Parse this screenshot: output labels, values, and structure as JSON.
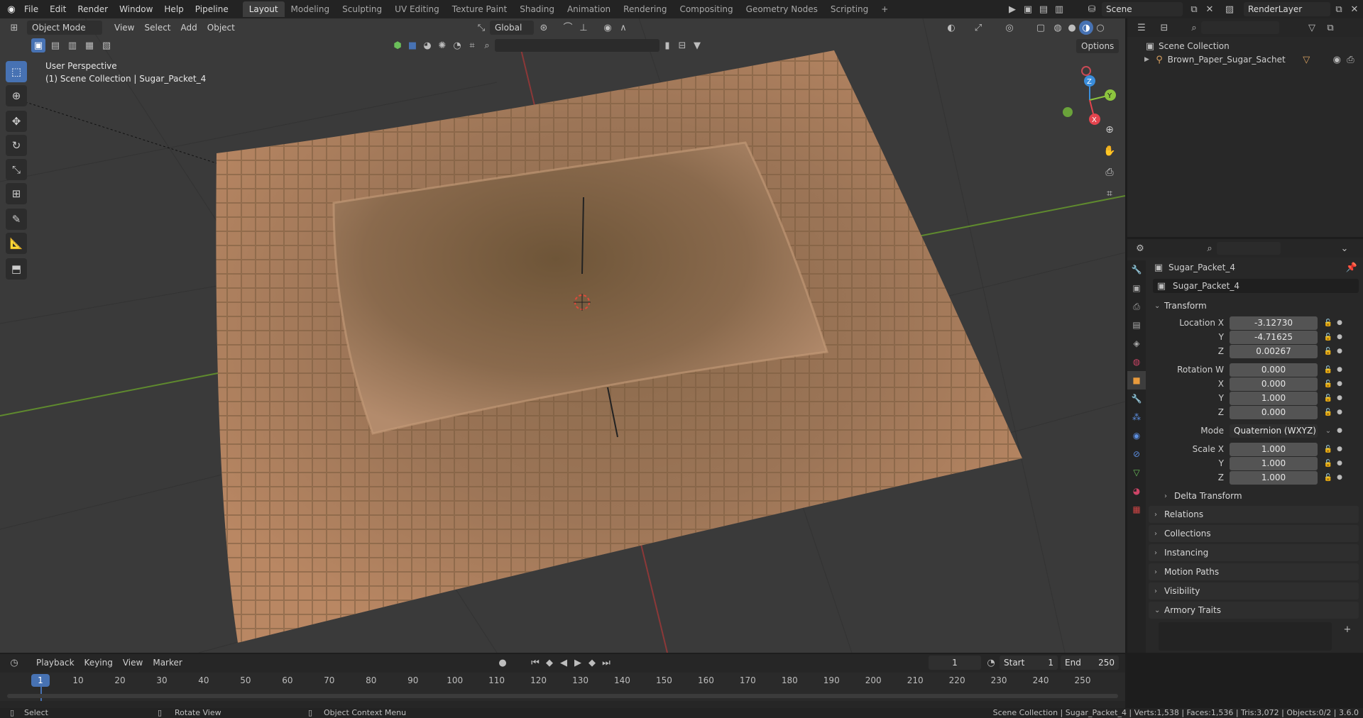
{
  "topbar": {
    "menus": [
      "File",
      "Edit",
      "Render",
      "Window",
      "Help",
      "Pipeline"
    ],
    "workspaces": [
      "Layout",
      "Modeling",
      "Sculpting",
      "UV Editing",
      "Texture Paint",
      "Shading",
      "Animation",
      "Rendering",
      "Compositing",
      "Geometry Nodes",
      "Scripting"
    ],
    "active_workspace": "Layout",
    "add_tab": "+",
    "scene_name": "Scene",
    "view_layer": "RenderLayer"
  },
  "viewport": {
    "mode": "Object Mode",
    "menus": [
      "View",
      "Select",
      "Add",
      "Object"
    ],
    "orientation": "Global",
    "options_label": "Options",
    "overlay_title": "User Perspective",
    "overlay_subtitle": "(1) Scene Collection | Sugar_Packet_4",
    "gizmo": {
      "x": "X",
      "y": "Y",
      "z": "Z"
    }
  },
  "outliner": {
    "root": "Scene Collection",
    "item": "Brown_Paper_Sugar_Sachet"
  },
  "properties": {
    "object_name": "Sugar_Packet_4",
    "data_name": "Sugar_Packet_4",
    "transform_label": "Transform",
    "location": {
      "label": "Location X",
      "x": "-3.12730",
      "y": "-4.71625",
      "z": "0.00267"
    },
    "rotation": {
      "label": "Rotation W",
      "w": "0.000",
      "x": "0.000",
      "y": "1.000",
      "z": "0.000"
    },
    "mode_label": "Mode",
    "mode_value": "Quaternion (WXYZ)",
    "scale": {
      "label": "Scale X",
      "x": "1.000",
      "y": "1.000",
      "z": "1.000"
    },
    "axis_labels": {
      "x": "X",
      "y": "Y",
      "z": "Z"
    },
    "delta": "Delta Transform",
    "sections": [
      "Relations",
      "Collections",
      "Instancing",
      "Motion Paths",
      "Visibility"
    ],
    "armory": "Armory Traits"
  },
  "timeline": {
    "menus": [
      "Playback",
      "Keying",
      "View",
      "Marker"
    ],
    "current_frame": "1",
    "start_label": "Start",
    "start": "1",
    "end_label": "End",
    "end": "250",
    "ticks": [
      "1",
      "10",
      "20",
      "30",
      "40",
      "50",
      "60",
      "70",
      "80",
      "90",
      "100",
      "110",
      "120",
      "130",
      "140",
      "150",
      "160",
      "170",
      "180",
      "190",
      "200",
      "210",
      "220",
      "230",
      "240",
      "250"
    ]
  },
  "statusbar": {
    "select": "Select",
    "rotate": "Rotate View",
    "context": "Object Context Menu",
    "info": "Scene Collection | Sugar_Packet_4 | Verts:1,538 | Faces:1,536 | Tris:3,072 | Objects:0/2 | 3.6.0"
  },
  "colors": {
    "accent": "#4772b3",
    "x_axis": "#e4444e",
    "y_axis": "#8cc43e",
    "z_axis": "#3a8ddb"
  }
}
